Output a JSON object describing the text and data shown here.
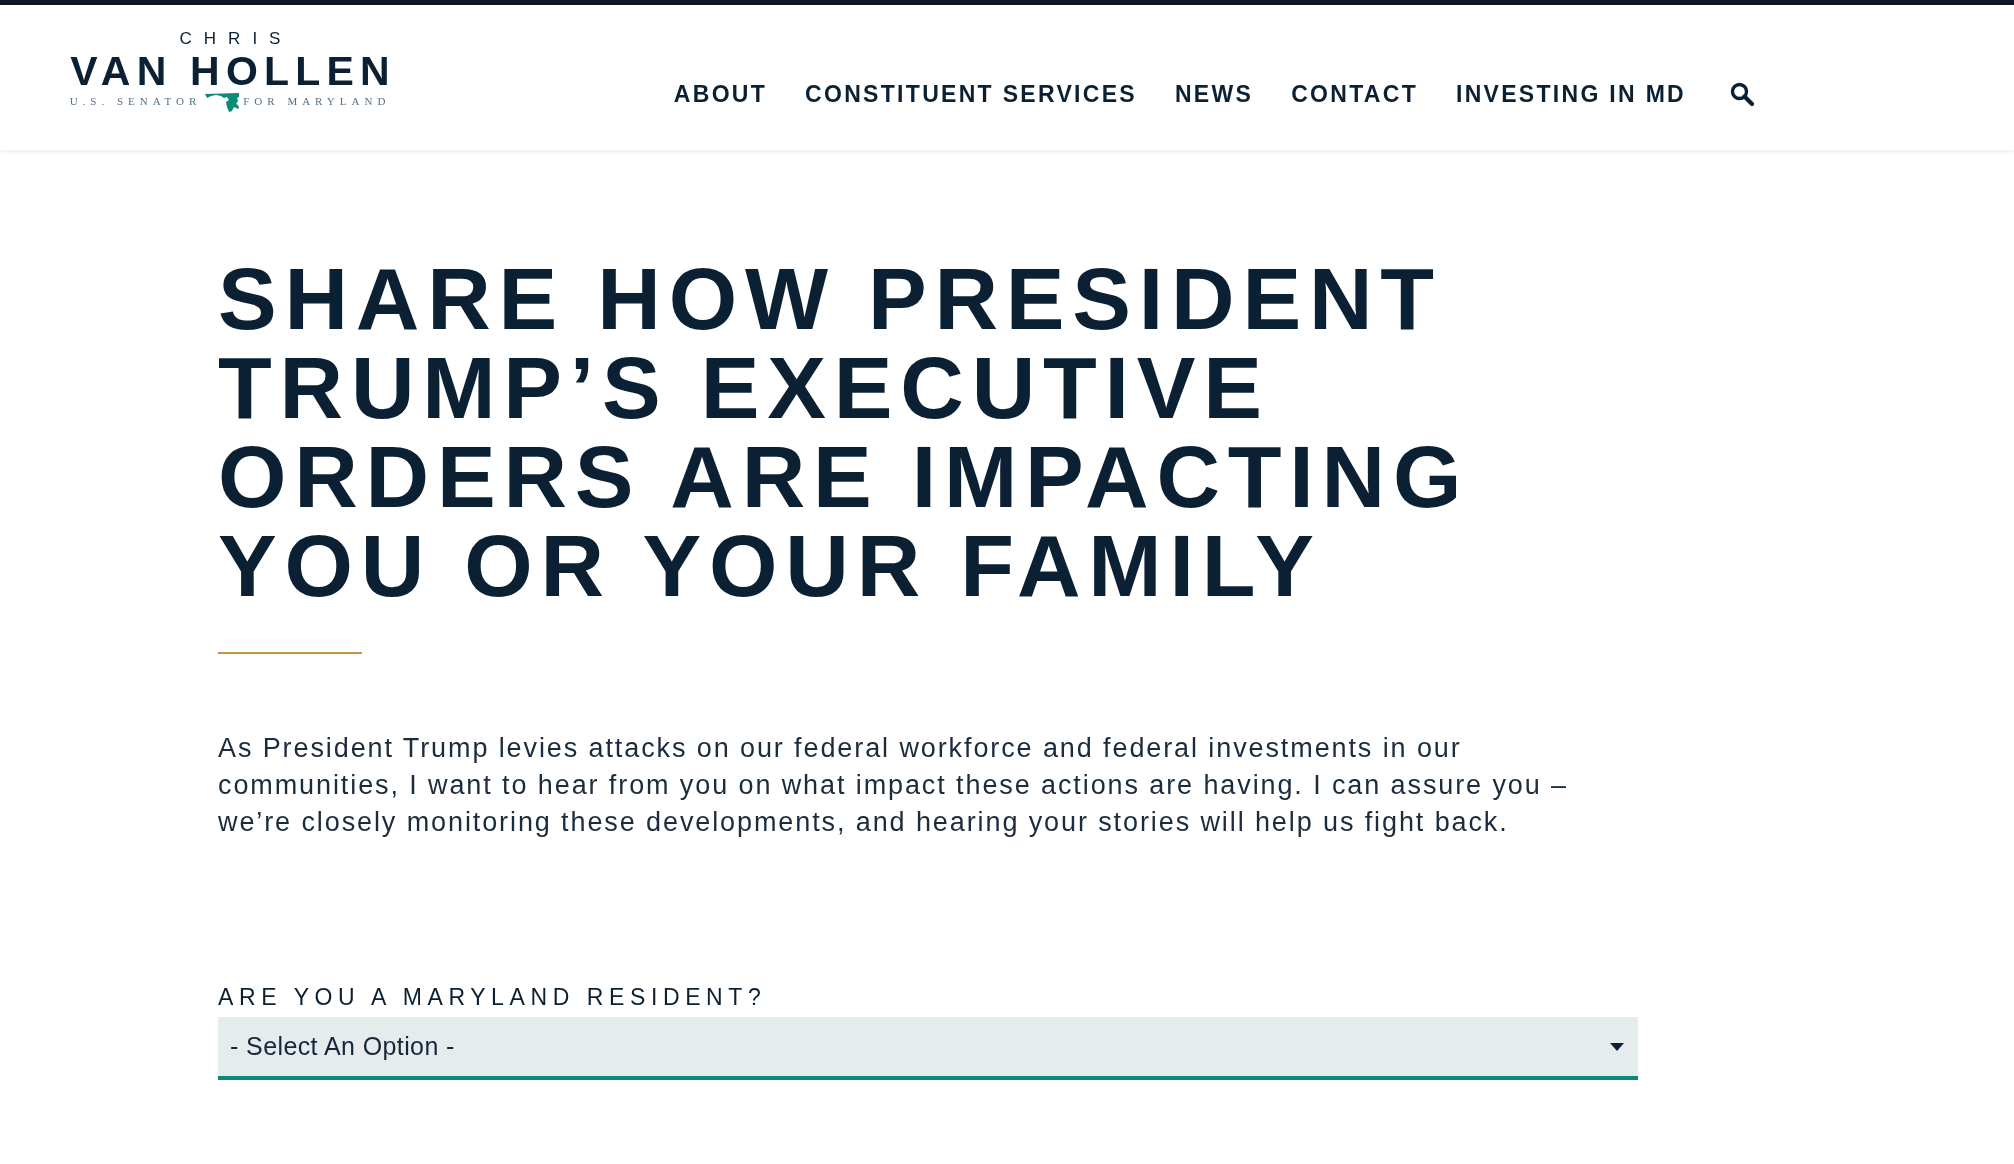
{
  "header": {
    "logo": {
      "first_name": "CHRIS",
      "last_name": "VAN HOLLEN",
      "tagline": [
        "U.S. SENATOR",
        "FOR MARYLAND"
      ]
    },
    "nav": [
      "ABOUT",
      "CONSTITUENT SERVICES",
      "NEWS",
      "CONTACT",
      "INVESTING IN MD"
    ]
  },
  "main": {
    "heading": "SHARE HOW PRESIDENT TRUMP’S EXECUTIVE ORDERS ARE IMPACTING YOU OR YOUR FAMILY",
    "intro": "As President Trump levies attacks on our federal workforce and federal investments in our communities, I want to hear from you on what impact these actions are having. I can assure you – we’re closely monitoring these developments, and hearing your stories will help us fight back.",
    "form": {
      "fields": [
        {
          "kind": "select",
          "label": "ARE YOU A MARYLAND RESIDENT?",
          "placeholder": "- Select An Option -"
        }
      ]
    }
  }
}
